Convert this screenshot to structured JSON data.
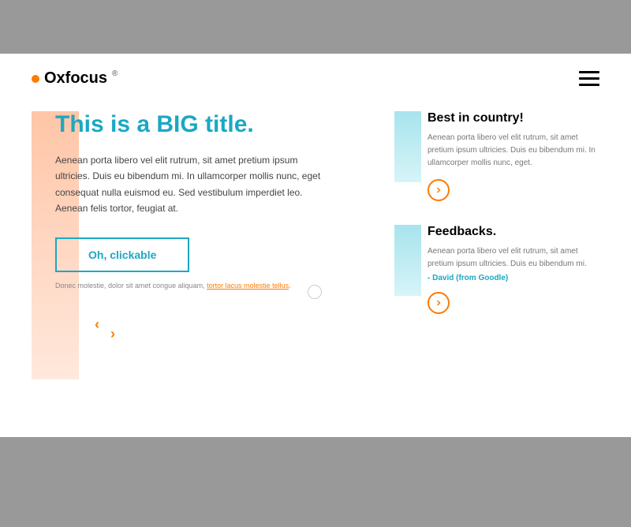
{
  "logo": {
    "text": "Oxfocus",
    "reg": "®"
  },
  "hero": {
    "title": "This is a BIG title.",
    "body": "Aenean porta libero vel elit rutrum, sit amet pretium ipsum ultricies. Duis eu bibendum mi. In ullamcorper mollis nunc, eget consequat nulla euismod eu. Sed vestibulum imperdiet leo. Aenean felis tortor, feugiat at.",
    "cta": "Oh, clickable",
    "footnote_pre": "Donec molestie, dolor sit amet congue aliquam, ",
    "footnote_link": "tortor lacus molestie tellus"
  },
  "cards": [
    {
      "title": "Best in country!",
      "body": "Aenean porta libero vel elit rutrum, sit amet pretium ipsum ultricies. Duis eu bibendum mi. In ullamcorper mollis nunc, eget."
    },
    {
      "title": "Feedbacks.",
      "body": "Aenean porta libero vel elit rutrum, sit amet pretium ipsum ultricies. Duis eu bibendum mi.",
      "author": "- David (from Goodle)"
    }
  ]
}
